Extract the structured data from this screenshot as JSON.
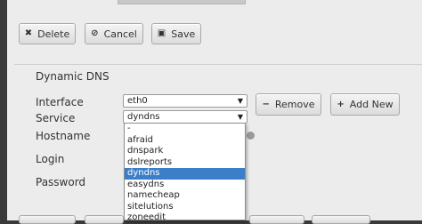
{
  "toolbar": {
    "delete_label": "Delete",
    "cancel_label": "Cancel",
    "save_label": "Save"
  },
  "ddns": {
    "title": "Dynamic DNS",
    "labels": {
      "interface": "Interface",
      "service": "Service",
      "hostname": "Hostname",
      "login": "Login",
      "password": "Password"
    },
    "interface_value": "eth0",
    "service_value": "dyndns",
    "remove_label": "Remove",
    "add_new_label": "Add New",
    "service_options": [
      "-",
      "afraid",
      "dnspark",
      "dslreports",
      "dyndns",
      "easydns",
      "namecheap",
      "sitelutions",
      "zoneedit"
    ],
    "selected_option": "dyndns"
  },
  "colors": {
    "selection": "#3c7fc8",
    "panel": "#ececec",
    "background": "#3a3a3a"
  }
}
